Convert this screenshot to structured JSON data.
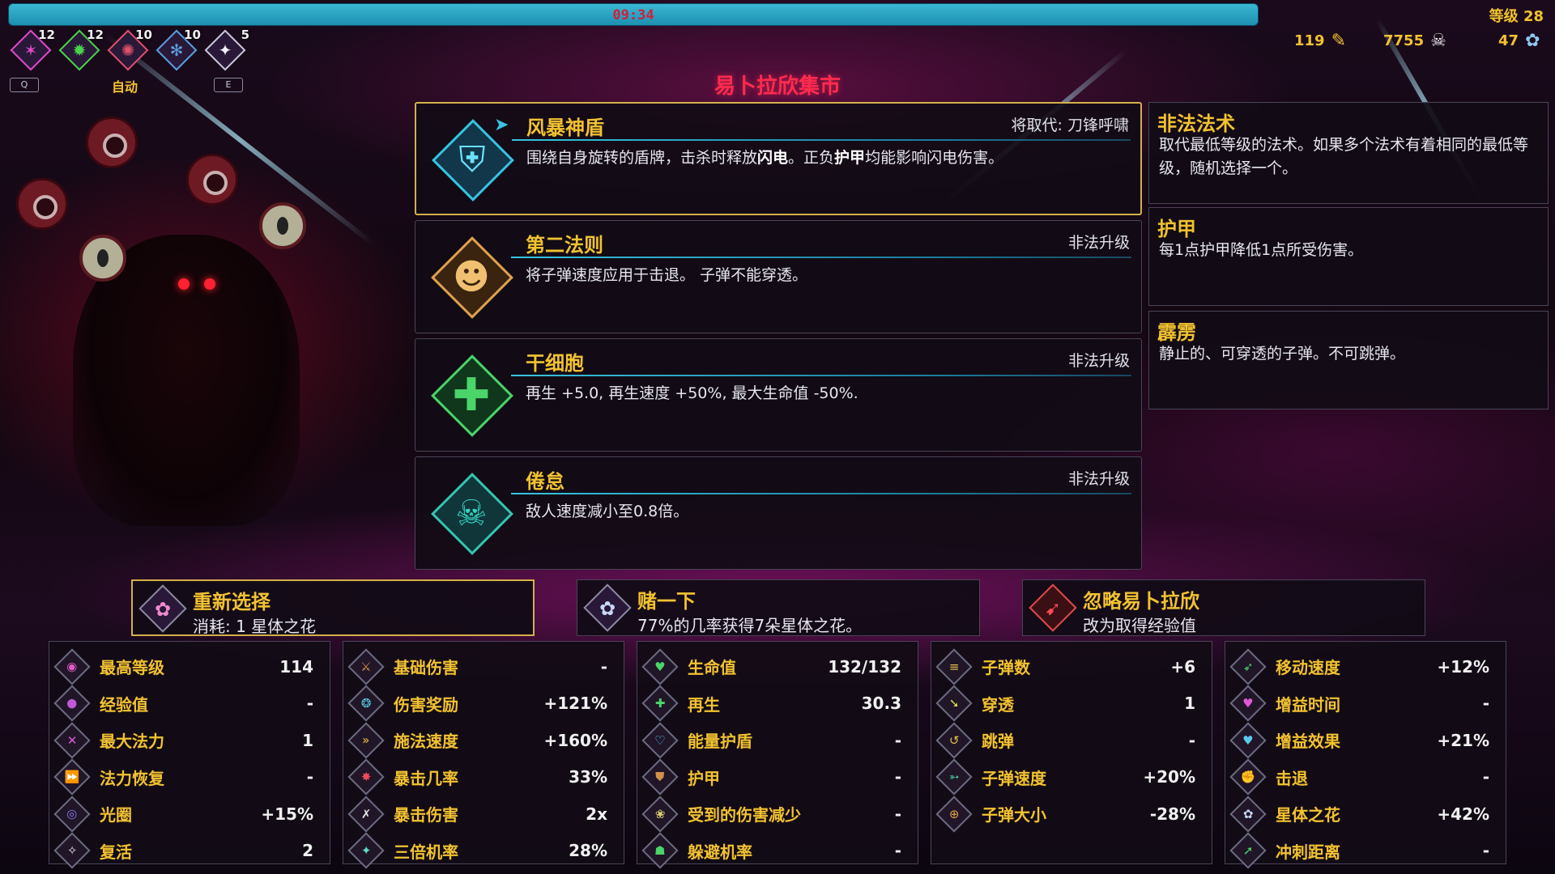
{
  "hud": {
    "timer": "09:34",
    "level": "等级 28",
    "auto_label": "自动",
    "key_q": "Q",
    "key_e": "E",
    "spells": [
      {
        "count": "12",
        "icon": "pink-star-icon",
        "color": "#e04acb",
        "glyph": "✶"
      },
      {
        "count": "12",
        "icon": "green-flame-icon",
        "color": "#4ad44a",
        "glyph": "✹"
      },
      {
        "count": "10",
        "icon": "red-spider-icon",
        "color": "#e0506a",
        "glyph": "✺"
      },
      {
        "count": "10",
        "icon": "blue-creature-icon",
        "color": "#5aa0e0",
        "glyph": "✻"
      },
      {
        "count": "5",
        "icon": "white-shuriken-icon",
        "color": "#f0f0f0",
        "glyph": "✦"
      }
    ],
    "resources": {
      "pencils": "119",
      "skulls": "7755",
      "stellar_flowers": "47"
    }
  },
  "market_title": "易卜拉欣集市",
  "cards": [
    {
      "title": "风暴神盾",
      "tag": "将取代: 刀锋呼啸",
      "desc_parts": [
        "围绕自身旋转的盾牌，击杀时释放",
        "闪电",
        "。正负",
        "护甲",
        "均能影响闪电伤害。"
      ],
      "icon": "shield-icon",
      "color": "#36c4e0"
    },
    {
      "title": "第二法则",
      "tag": "非法升级",
      "desc": "将子弹速度应用于击退。 子弹不能穿透。",
      "icon": "face-mask-icon",
      "color": "#e0a050"
    },
    {
      "title": "干细胞",
      "tag": "非法升级",
      "desc": "再生 +5.0, 再生速度 +50%, 最大生命值 -50%.",
      "icon": "green-cross-icon",
      "color": "#4ad46a"
    },
    {
      "title": "倦怠",
      "tag": "非法升级",
      "desc": "敌人速度减小至0.8倍。",
      "icon": "skull-icon",
      "color": "#36c4b0"
    }
  ],
  "info_panels": [
    {
      "title": "非法法术",
      "desc": "取代最低等级的法术。如果多个法术有着相同的最低等级，随机选择一个。"
    },
    {
      "title": "护甲",
      "desc": "每1点护甲降低1点所受伤害。"
    },
    {
      "title": "霹雳",
      "desc": "静止的、可穿透的子弹。不可跳弹。"
    }
  ],
  "actions": [
    {
      "title": "重新选择",
      "desc": "消耗: 1 星体之花",
      "icon": "stellar-flower-icon"
    },
    {
      "title": "赌一下",
      "desc": "77%的几率获得7朵星体之花。",
      "icon": "stellar-flower-icon"
    },
    {
      "title": "忽略易卜拉欣",
      "desc": "改为取得经验值",
      "icon": "skip-arrow-icon"
    }
  ],
  "stats": [
    [
      {
        "label": "最高等级",
        "value": "114",
        "icon": "swirl-icon"
      },
      {
        "label": "经验值",
        "value": "-",
        "icon": "orb-icon"
      },
      {
        "label": "最大法力",
        "value": "1",
        "icon": "crossed-icon"
      },
      {
        "label": "法力恢复",
        "value": "-",
        "icon": "fast-forward-icon"
      },
      {
        "label": "光圈",
        "value": "+15%",
        "icon": "eye-icon"
      },
      {
        "label": "复活",
        "value": "2",
        "icon": "wings-icon"
      }
    ],
    [
      {
        "label": "基础伤害",
        "value": "-",
        "icon": "sword-icon"
      },
      {
        "label": "伤害奖励",
        "value": "+121%",
        "icon": "brain-icon"
      },
      {
        "label": "施法速度",
        "value": "+160%",
        "icon": "double-arrow-icon"
      },
      {
        "label": "暴击几率",
        "value": "33%",
        "icon": "burst-icon"
      },
      {
        "label": "暴击伤害",
        "value": "2x",
        "icon": "claw-icon"
      },
      {
        "label": "三倍机率",
        "value": "28%",
        "icon": "triple-icon"
      }
    ],
    [
      {
        "label": "生命值",
        "value": "132/132",
        "icon": "heart-icon"
      },
      {
        "label": "再生",
        "value": "30.3",
        "icon": "cross-icon"
      },
      {
        "label": "能量护盾",
        "value": "-",
        "icon": "shield-heart-icon"
      },
      {
        "label": "护甲",
        "value": "-",
        "icon": "armor-icon"
      },
      {
        "label": "受到的伤害减少",
        "value": "-",
        "icon": "flower-shield-icon"
      },
      {
        "label": "躲避机率",
        "value": "-",
        "icon": "dodge-icon"
      }
    ],
    [
      {
        "label": "子弹数",
        "value": "+6",
        "icon": "bullets-icon"
      },
      {
        "label": "穿透",
        "value": "1",
        "icon": "pierce-icon"
      },
      {
        "label": "跳弹",
        "value": "-",
        "icon": "bounce-icon"
      },
      {
        "label": "子弹速度",
        "value": "+20%",
        "icon": "wing-bullet-icon"
      },
      {
        "label": "子弹大小",
        "value": "-28%",
        "icon": "size-icon"
      }
    ],
    [
      {
        "label": "移动速度",
        "value": "+12%",
        "icon": "boot-icon"
      },
      {
        "label": "增益时间",
        "value": "-",
        "icon": "heart-time-icon"
      },
      {
        "label": "增益效果",
        "value": "+21%",
        "icon": "heart-buff-icon"
      },
      {
        "label": "击退",
        "value": "-",
        "icon": "knockback-icon"
      },
      {
        "label": "星体之花",
        "value": "+42%",
        "icon": "stellar-flower-icon"
      },
      {
        "label": "冲刺距离",
        "value": "-",
        "icon": "dash-icon"
      }
    ]
  ]
}
